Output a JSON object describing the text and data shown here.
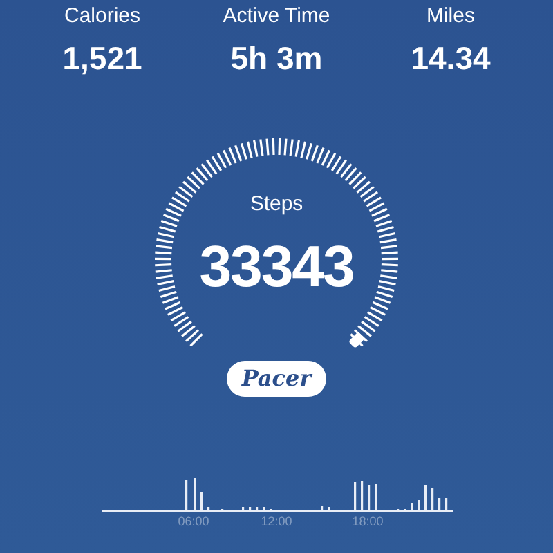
{
  "stats": [
    {
      "label": "Calories",
      "value": "1,521"
    },
    {
      "label": "Active Time",
      "value": "5h 3m"
    },
    {
      "label": "Miles",
      "value": "14.34"
    }
  ],
  "gauge": {
    "label": "Steps",
    "value": "33343"
  },
  "brand": "Pacer",
  "activity": {
    "time_labels": [
      "06:00",
      "12:00",
      "18:00"
    ]
  }
}
